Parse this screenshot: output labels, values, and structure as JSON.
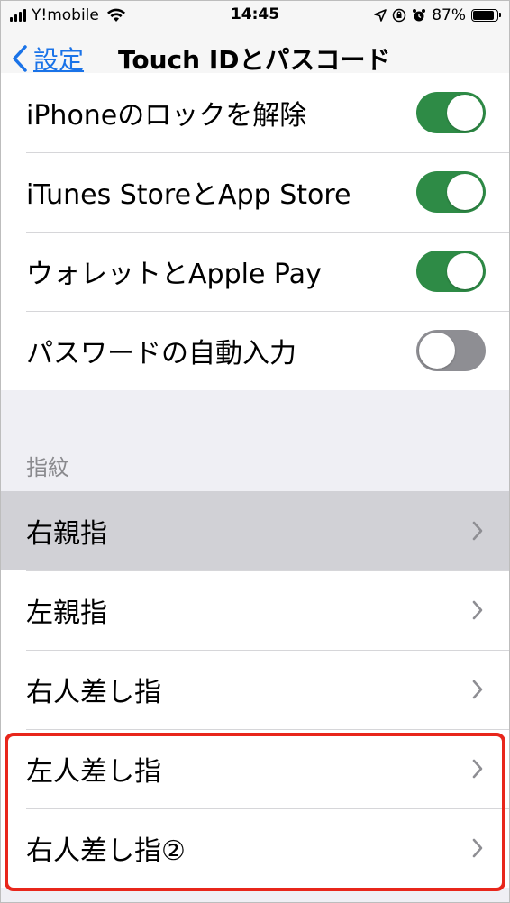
{
  "status_bar": {
    "carrier": "Y!mobile",
    "time": "14:45",
    "battery_percent": "87%",
    "battery_level": 0.87
  },
  "nav": {
    "back_label": "設定",
    "title": "Touch IDとパスコード"
  },
  "toggle_rows": [
    {
      "label": "iPhoneのロックを解除",
      "on": true
    },
    {
      "label": "iTunes StoreとApp Store",
      "on": true
    },
    {
      "label": "ウォレットとApple Pay",
      "on": true
    },
    {
      "label": "パスワードの自動入力",
      "on": false
    }
  ],
  "fingerprint_section": {
    "header": "指紋",
    "items": [
      {
        "label": "右親指",
        "highlighted": true
      },
      {
        "label": "左親指"
      },
      {
        "label": "右人差し指"
      },
      {
        "label": "左人差し指",
        "boxed": true
      },
      {
        "label": "右人差し指②",
        "boxed": true
      }
    ]
  },
  "colors": {
    "toggle_on": "#2e8b46",
    "toggle_off": "#8e8e93",
    "accent": "#1a73e8",
    "annotation_box": "#e8261b"
  },
  "icons": {
    "back": "chevron-left-icon",
    "disclosure": "chevron-right-icon",
    "wifi": "wifi-icon",
    "location": "location-arrow-icon",
    "orientation_lock": "orientation-lock-icon",
    "alarm": "alarm-icon",
    "battery": "battery-icon"
  }
}
